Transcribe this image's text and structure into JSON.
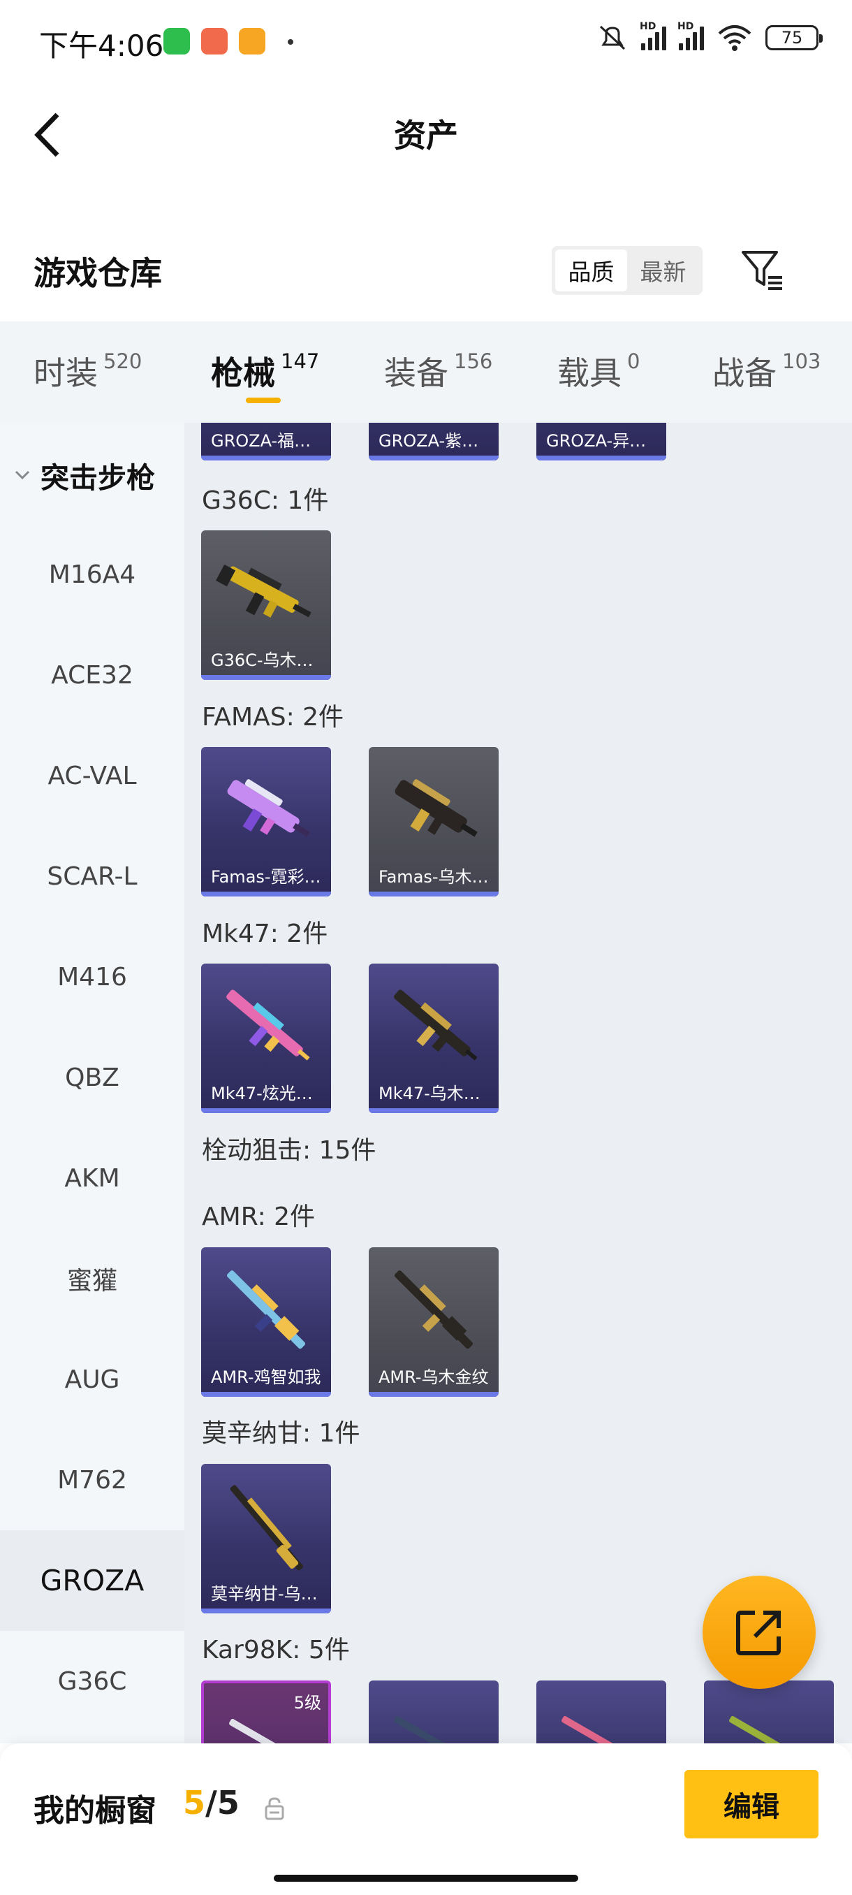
{
  "status_bar": {
    "time": "下午4:06",
    "battery": "75",
    "app_icon_colors": [
      "#2dbe4e",
      "#f06a4b",
      "#f7a623"
    ]
  },
  "header": {
    "title": "资产",
    "back_icon": "chevron-left-icon"
  },
  "warehouse": {
    "title": "游戏仓库",
    "sort_options": [
      "品质",
      "最新"
    ],
    "active_sort": "品质",
    "filter_icon": "filter-icon"
  },
  "tabs": [
    {
      "label": "时装",
      "count": "520"
    },
    {
      "label": "枪械",
      "count": "147"
    },
    {
      "label": "装备",
      "count": "156"
    },
    {
      "label": "载具",
      "count": "0"
    },
    {
      "label": "战备",
      "count": "103"
    }
  ],
  "active_tab": "枪械",
  "sidebar": {
    "group": "突击步枪",
    "items": [
      "M16A4",
      "ACE32",
      "AC-VAL",
      "SCAR-L",
      "M416",
      "QBZ",
      "AKM",
      "蜜獾",
      "AUG",
      "M762",
      "GROZA",
      "G36C"
    ],
    "active_item": "GROZA"
  },
  "content": {
    "top_cards": [
      "GROZA-福…",
      "GROZA-紫…",
      "GROZA-异…"
    ],
    "groups": [
      {
        "heading": "G36C: 1件",
        "cards": [
          {
            "name": "G36C-乌木…",
            "style": "gray"
          }
        ]
      },
      {
        "heading": "FAMAS: 2件",
        "cards": [
          {
            "name": "Famas-霓彩…",
            "style": "purple"
          },
          {
            "name": "Famas-乌木…",
            "style": "gray"
          }
        ]
      },
      {
        "heading": "Mk47: 2件",
        "cards": [
          {
            "name": "Mk47-炫光…",
            "style": "purple"
          },
          {
            "name": "Mk47-乌木…",
            "style": "purple"
          }
        ]
      },
      {
        "heading": "栓动狙击: 15件",
        "cards": []
      },
      {
        "heading": "AMR: 2件",
        "cards": [
          {
            "name": "AMR-鸡智如我",
            "style": "purple"
          },
          {
            "name": "AMR-乌木金纹",
            "style": "gray"
          }
        ]
      },
      {
        "heading": "莫辛纳甘: 1件",
        "cards": [
          {
            "name": "莫辛纳甘-乌…",
            "style": "purple"
          }
        ]
      },
      {
        "heading": "Kar98K: 5件",
        "cards": []
      }
    ],
    "kar98k_level_badge": "5级"
  },
  "fab": {
    "icon": "external-link-icon"
  },
  "bottom": {
    "label": "我的橱窗",
    "count_current": "5",
    "count_sep": "/",
    "count_total": "5",
    "lock_icon": "lock-icon",
    "edit_label": "编辑"
  },
  "colors": {
    "accent": "#f6b100",
    "edit_button": "#ffbf13",
    "card_bar": "#6a79e6"
  }
}
